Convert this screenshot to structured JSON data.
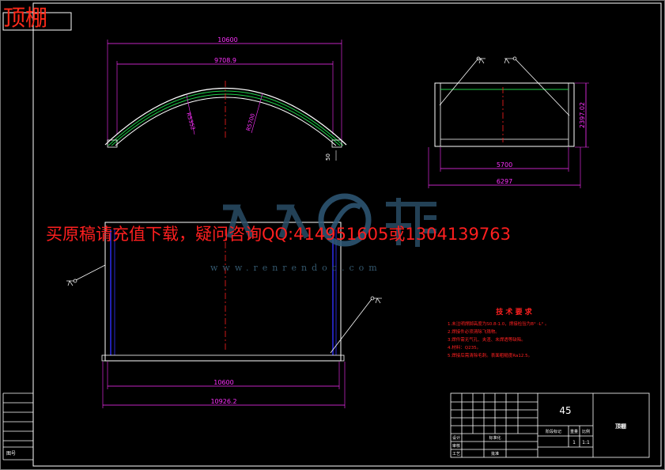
{
  "sheet": {
    "title_tag": "顶棚",
    "colors": {
      "frame": "#ffffff",
      "dimension": "#ff30ff",
      "center_line": "#ff2020",
      "green_line": "#1fd04a",
      "blue_line": "#3030ff",
      "notes": "#ff2020",
      "watermark": "#305a78"
    }
  },
  "views": {
    "front_arc": {
      "dims": {
        "overall_width": "10600",
        "chord_width": "9708.9",
        "radius_inner": "R5352",
        "radius_outer": "R5700",
        "thickness": "50"
      }
    },
    "side": {
      "dims": {
        "height": "2397.02",
        "inner_width": "5700",
        "outer_width": "6297"
      }
    },
    "plan": {
      "dims": {
        "inner_width": "10600",
        "outer_width": "10926.2"
      }
    }
  },
  "watermark": {
    "notice": "买原稿请充值下载，疑问咨询QQ:414951605或1304139763",
    "url": "www.renrendoc.com",
    "logo": "人人文库"
  },
  "tech_notes": {
    "title": "技 术 要 求",
    "items": [
      "1.未注明焊脚高度为S0.8-1.0，焊接检验为B° -L° 。",
      "2.焊接件必须清除飞溅物。",
      "3.焊件需无气孔、夹渣、未焊透等缺陷。",
      "4.材料：Q235。",
      "5.焊接后需清除毛刺。表面粗糙度Ra12.5。"
    ]
  },
  "title_block": {
    "part_no": "45",
    "name": "顶棚",
    "scale": "1:1",
    "qty": "1",
    "labels": {
      "designer": "设计",
      "checker": "审核",
      "std": "标准化",
      "approve": "批准",
      "craft": "工艺",
      "stage": "阶段标记",
      "weight": "重量",
      "ratio": "比例"
    },
    "side_label": "图号"
  }
}
